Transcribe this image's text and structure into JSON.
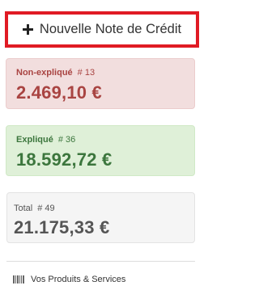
{
  "new_button": {
    "icon": "plus-icon",
    "label": "Nouvelle Note de Crédit"
  },
  "cards": {
    "unexplained": {
      "label": "Non-expliqué",
      "count": "# 13",
      "amount": "2.469,10 €",
      "color": "#a94442"
    },
    "explained": {
      "label": "Expliqué",
      "count": "# 36",
      "amount": "18.592,72 €",
      "color": "#3c763d"
    },
    "total": {
      "label": "Total",
      "count": "# 49",
      "amount": "21.175,33 €",
      "color": "#555555"
    }
  },
  "products_link": {
    "icon": "barcode-icon",
    "label": "Vos Produits & Services"
  },
  "colors": {
    "highlight_border": "#e01b24"
  }
}
